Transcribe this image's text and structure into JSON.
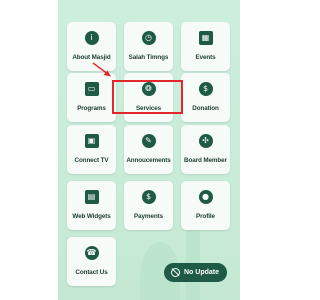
{
  "menu": {
    "tiles": [
      {
        "label": "About Masjid",
        "icon": "info-icon",
        "glyph": "i"
      },
      {
        "label": "Salah Timngs",
        "icon": "clock-icon",
        "glyph": "◷"
      },
      {
        "label": "Events",
        "icon": "calendar-icon",
        "glyph": "▦"
      },
      {
        "label": "Programs",
        "icon": "presentation-icon",
        "glyph": "▭"
      },
      {
        "label": "Services",
        "icon": "services-icon",
        "glyph": "❂"
      },
      {
        "label": "Donation",
        "icon": "donation-hand-icon",
        "glyph": "$"
      },
      {
        "label": "Connect TV",
        "icon": "tv-cast-icon",
        "glyph": "▣"
      },
      {
        "label": "Annoucements",
        "icon": "megaphone-icon",
        "glyph": "✎"
      },
      {
        "label": "Board Member",
        "icon": "board-members-icon",
        "glyph": "✣"
      },
      {
        "label": "Web Widgets",
        "icon": "web-widget-icon",
        "glyph": "▤"
      },
      {
        "label": "Payments",
        "icon": "dollar-coin-icon",
        "glyph": "$"
      },
      {
        "label": "Profile",
        "icon": "profile-icon",
        "glyph": "●"
      },
      {
        "label": "Contact Us",
        "icon": "contact-headset-icon",
        "glyph": "☎"
      }
    ]
  },
  "status_button": {
    "label": "No Update",
    "icon": "no-sync-icon"
  },
  "annotation": {
    "highlight_color": "#e0282d",
    "highlighted_tile": "Services"
  },
  "colors": {
    "accent": "#1e5a45",
    "background": "#cdeedd",
    "tile": "#f6fbf8"
  }
}
